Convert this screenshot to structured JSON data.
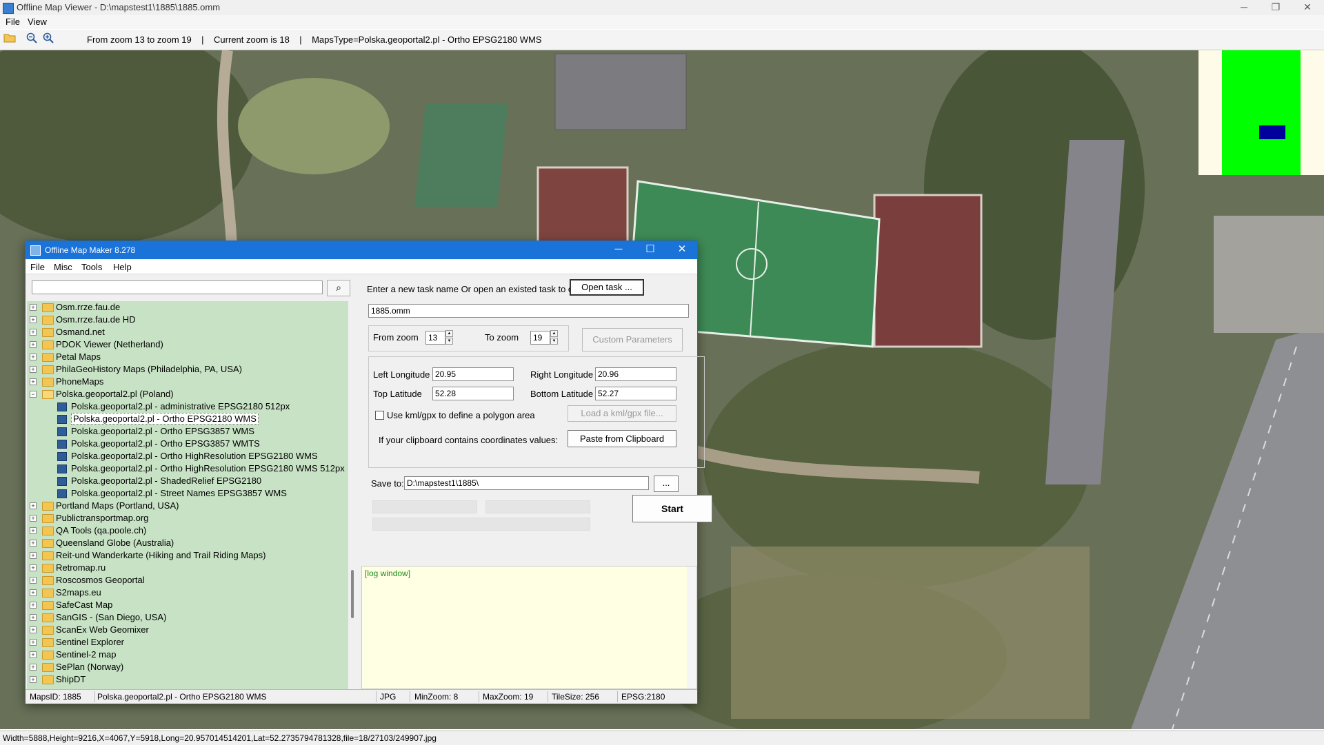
{
  "window": {
    "title": "Offline Map Viewer - D:\\mapstest1\\1885\\1885.omm",
    "controls": {
      "minimize": "─",
      "restore": "❐",
      "close": "✕"
    }
  },
  "menu": {
    "file": "File",
    "view": "View"
  },
  "toolbar": {
    "info": "From zoom 13 to zoom 19    |    Current zoom is 18    |    MapsType=Polska.geoportal2.pl - Ortho EPSG2180 WMS",
    "icons": [
      "open-folder-icon",
      "zoom-out-icon",
      "zoom-in-icon"
    ]
  },
  "statusbar": {
    "text": "Width=5888,Height=9216,X=4067,Y=5918,Long=20.957014514201,Lat=52.2735794781328,file=18/27103/249907.jpg"
  },
  "minimap": {
    "colors": {
      "background": "#fffbe9",
      "area": "#00ff00",
      "viewport": "#00009a"
    }
  },
  "dialog": {
    "title": "Offline Map Maker 8.278",
    "controls": {
      "minimize": "─",
      "maximize": "☐",
      "close": "✕"
    },
    "menu": [
      "File",
      "Misc",
      "Tools",
      "Help"
    ],
    "search": {
      "value": "",
      "button_icon": "search-icon",
      "button_glyph": "⌕"
    },
    "tree": [
      {
        "label": "Osm.rrze.fau.de",
        "level": 0,
        "expanded": false
      },
      {
        "label": "Osm.rrze.fau.de HD",
        "level": 0,
        "expanded": false
      },
      {
        "label": "Osmand.net",
        "level": 0,
        "expanded": false
      },
      {
        "label": "PDOK Viewer (Netherland)",
        "level": 0,
        "expanded": false
      },
      {
        "label": "Petal Maps",
        "level": 0,
        "expanded": false
      },
      {
        "label": "PhilaGeoHistory Maps (Philadelphia, PA, USA)",
        "level": 0,
        "expanded": false
      },
      {
        "label": "PhoneMaps",
        "level": 0,
        "expanded": false
      },
      {
        "label": "Polska.geoportal2.pl (Poland)",
        "level": 0,
        "expanded": true
      },
      {
        "label": "Polska.geoportal2.pl - administrative EPSG2180 512px",
        "level": 1
      },
      {
        "label": "Polska.geoportal2.pl - Ortho EPSG2180 WMS",
        "level": 1,
        "selected": true
      },
      {
        "label": "Polska.geoportal2.pl - Ortho EPSG3857 WMS",
        "level": 1
      },
      {
        "label": "Polska.geoportal2.pl - Ortho EPSG3857 WMTS",
        "level": 1
      },
      {
        "label": "Polska.geoportal2.pl - Ortho HighResolution EPSG2180 WMS",
        "level": 1
      },
      {
        "label": "Polska.geoportal2.pl - Ortho HighResolution EPSG2180 WMS 512px",
        "level": 1
      },
      {
        "label": "Polska.geoportal2.pl - ShadedRelief EPSG2180",
        "level": 1
      },
      {
        "label": "Polska.geoportal2.pl - Street Names EPSG3857 WMS",
        "level": 1
      },
      {
        "label": "Portland Maps (Portland, USA)",
        "level": 0,
        "expanded": false
      },
      {
        "label": "Publictransportmap.org",
        "level": 0,
        "expanded": false
      },
      {
        "label": "QA Tools (qa.poole.ch)",
        "level": 0,
        "expanded": false
      },
      {
        "label": "Queensland Globe (Australia)",
        "level": 0,
        "expanded": false
      },
      {
        "label": "Reit-und Wanderkarte (Hiking and Trail Riding Maps)",
        "level": 0,
        "expanded": false
      },
      {
        "label": "Retromap.ru",
        "level": 0,
        "expanded": false
      },
      {
        "label": "Roscosmos Geoportal",
        "level": 0,
        "expanded": false
      },
      {
        "label": "S2maps.eu",
        "level": 0,
        "expanded": false
      },
      {
        "label": "SafeCast Map",
        "level": 0,
        "expanded": false
      },
      {
        "label": "SanGIS - (San Diego, USA)",
        "level": 0,
        "expanded": false
      },
      {
        "label": "ScanEx Web Geomixer",
        "level": 0,
        "expanded": false
      },
      {
        "label": "Sentinel Explorer",
        "level": 0,
        "expanded": false
      },
      {
        "label": "Sentinel-2 map",
        "level": 0,
        "expanded": false
      },
      {
        "label": "SePlan (Norway)",
        "level": 0,
        "expanded": false
      },
      {
        "label": "ShipDT",
        "level": 0,
        "expanded": false
      }
    ],
    "task": {
      "prompt": "Enter a new task name Or open an existed task to continue:",
      "open_button": "Open task ...",
      "name_value": "1885.omm"
    },
    "zoom": {
      "from_label": "From zoom",
      "from_value": "13",
      "to_label": "To zoom",
      "to_value": "19",
      "custom_button": "Custom Parameters"
    },
    "coords": {
      "left_lon_label": "Left Longitude",
      "left_lon_value": "20.95",
      "right_lon_label": "Right Longitude",
      "right_lon_value": "20.96",
      "top_lat_label": "Top Latitude",
      "top_lat_value": "52.28",
      "bottom_lat_label": "Bottom Latitude",
      "bottom_lat_value": "52.27",
      "kml_label": "Use kml/gpx to define a polygon area",
      "kml_checked": false,
      "kml_button": "Load a kml/gpx file...",
      "clipboard_label": "If your clipboard contains coordinates values:",
      "clipboard_button": "Paste from Clipboard"
    },
    "save": {
      "label": "Save to:",
      "value": "D:\\mapstest1\\1885\\",
      "browse_button": "..."
    },
    "start_button": "Start",
    "log_text": "[log window]",
    "status": {
      "maps_id": "MapsID: 1885",
      "maps_name": "Polska.geoportal2.pl - Ortho EPSG2180 WMS",
      "format": "JPG",
      "min_zoom": "MinZoom: 8",
      "max_zoom": "MaxZoom: 19",
      "tile_size": "TileSize: 256",
      "epsg": "EPSG:2180"
    }
  }
}
